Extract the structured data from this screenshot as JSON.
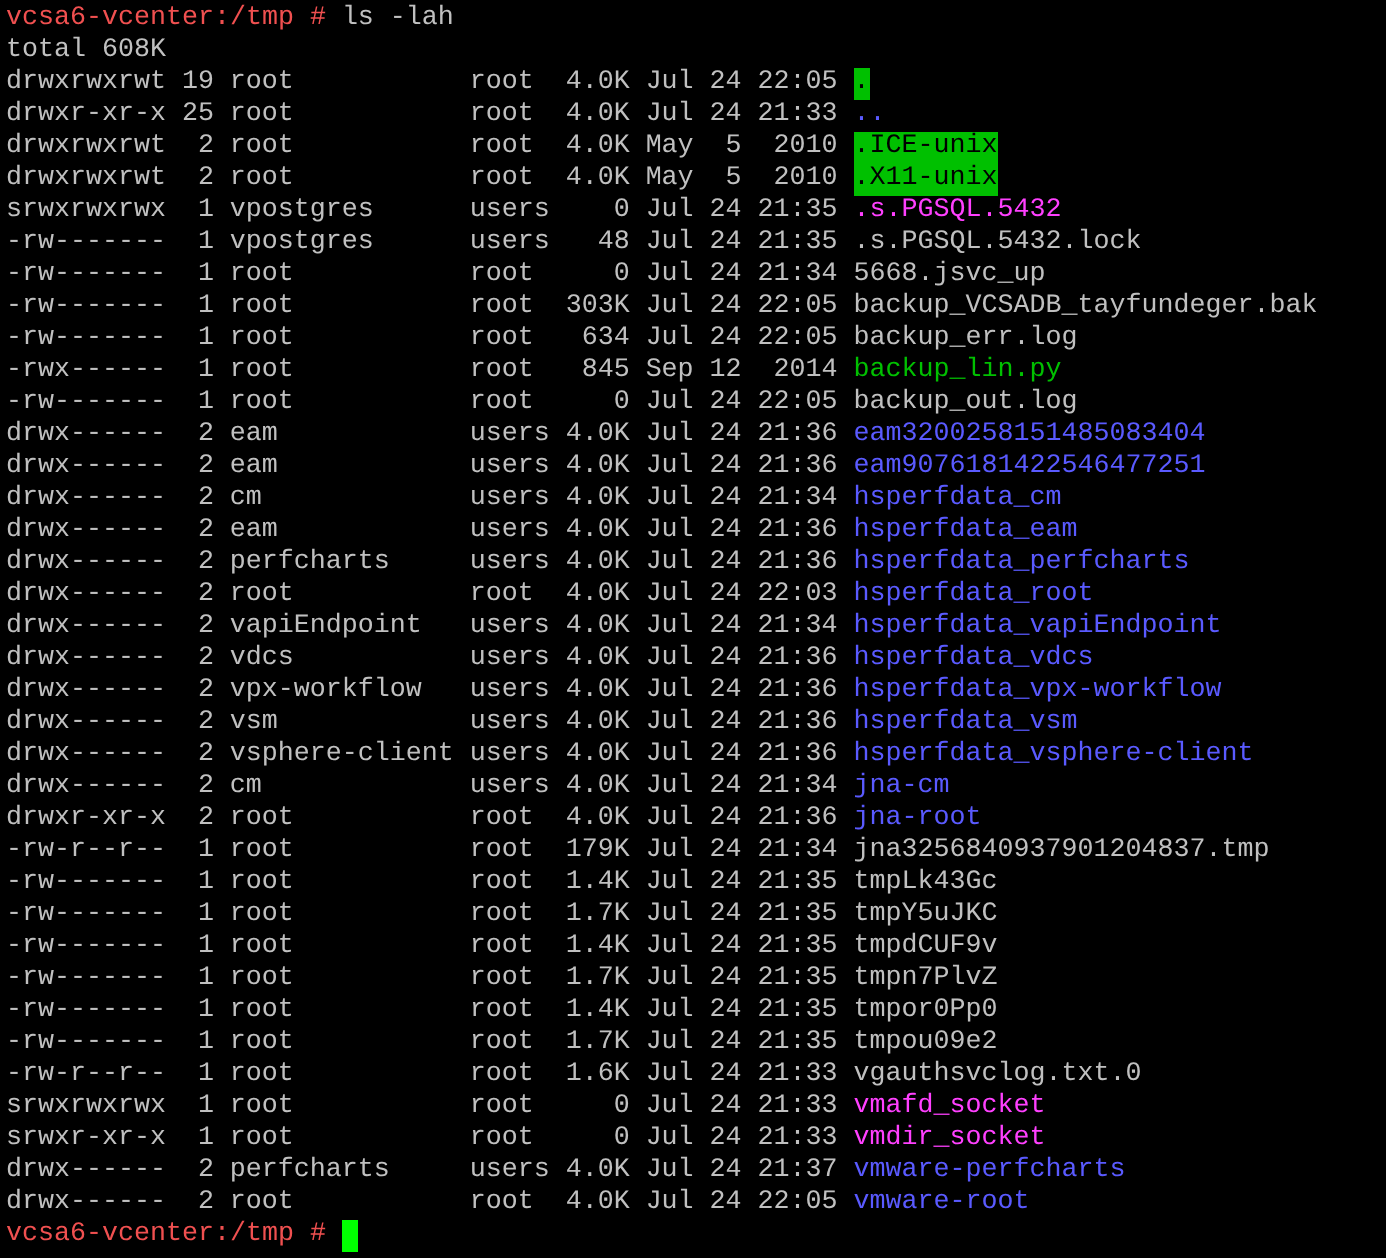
{
  "prompt_top": {
    "host": "vcsa6-vcenter:/tmp",
    "symbol": "#",
    "command": "ls -lah"
  },
  "total": "total 608K",
  "entries": [
    {
      "perms": "drwxrwxrwt",
      "links": "19",
      "owner": "root",
      "group": "root",
      "size": "4.0K",
      "date": "Jul 24 22:05",
      "name": ".",
      "kind": "sticky_dir"
    },
    {
      "perms": "drwxr-xr-x",
      "links": "25",
      "owner": "root",
      "group": "root",
      "size": "4.0K",
      "date": "Jul 24 21:33",
      "name": "..",
      "kind": "dir"
    },
    {
      "perms": "drwxrwxrwt",
      "links": "2",
      "owner": "root",
      "group": "root",
      "size": "4.0K",
      "date": "May  5  2010",
      "name": ".ICE-unix",
      "kind": "sticky_dir"
    },
    {
      "perms": "drwxrwxrwt",
      "links": "2",
      "owner": "root",
      "group": "root",
      "size": "4.0K",
      "date": "May  5  2010",
      "name": ".X11-unix",
      "kind": "sticky_dir"
    },
    {
      "perms": "srwxrwxrwx",
      "links": "1",
      "owner": "vpostgres",
      "group": "users",
      "size": "0",
      "date": "Jul 24 21:35",
      "name": ".s.PGSQL.5432",
      "kind": "socket"
    },
    {
      "perms": "-rw-------",
      "links": "1",
      "owner": "vpostgres",
      "group": "users",
      "size": "48",
      "date": "Jul 24 21:35",
      "name": ".s.PGSQL.5432.lock",
      "kind": "file"
    },
    {
      "perms": "-rw-------",
      "links": "1",
      "owner": "root",
      "group": "root",
      "size": "0",
      "date": "Jul 24 21:34",
      "name": "5668.jsvc_up",
      "kind": "file"
    },
    {
      "perms": "-rw-------",
      "links": "1",
      "owner": "root",
      "group": "root",
      "size": "303K",
      "date": "Jul 24 22:05",
      "name": "backup_VCSADB_tayfundeger.bak",
      "kind": "file"
    },
    {
      "perms": "-rw-------",
      "links": "1",
      "owner": "root",
      "group": "root",
      "size": "634",
      "date": "Jul 24 22:05",
      "name": "backup_err.log",
      "kind": "file"
    },
    {
      "perms": "-rwx------",
      "links": "1",
      "owner": "root",
      "group": "root",
      "size": "845",
      "date": "Sep 12  2014",
      "name": "backup_lin.py",
      "kind": "executable"
    },
    {
      "perms": "-rw-------",
      "links": "1",
      "owner": "root",
      "group": "root",
      "size": "0",
      "date": "Jul 24 22:05",
      "name": "backup_out.log",
      "kind": "file"
    },
    {
      "perms": "drwx------",
      "links": "2",
      "owner": "eam",
      "group": "users",
      "size": "4.0K",
      "date": "Jul 24 21:36",
      "name": "eam3200258151485083404",
      "kind": "dir"
    },
    {
      "perms": "drwx------",
      "links": "2",
      "owner": "eam",
      "group": "users",
      "size": "4.0K",
      "date": "Jul 24 21:36",
      "name": "eam9076181422546477251",
      "kind": "dir"
    },
    {
      "perms": "drwx------",
      "links": "2",
      "owner": "cm",
      "group": "users",
      "size": "4.0K",
      "date": "Jul 24 21:34",
      "name": "hsperfdata_cm",
      "kind": "dir"
    },
    {
      "perms": "drwx------",
      "links": "2",
      "owner": "eam",
      "group": "users",
      "size": "4.0K",
      "date": "Jul 24 21:36",
      "name": "hsperfdata_eam",
      "kind": "dir"
    },
    {
      "perms": "drwx------",
      "links": "2",
      "owner": "perfcharts",
      "group": "users",
      "size": "4.0K",
      "date": "Jul 24 21:36",
      "name": "hsperfdata_perfcharts",
      "kind": "dir"
    },
    {
      "perms": "drwx------",
      "links": "2",
      "owner": "root",
      "group": "root",
      "size": "4.0K",
      "date": "Jul 24 22:03",
      "name": "hsperfdata_root",
      "kind": "dir"
    },
    {
      "perms": "drwx------",
      "links": "2",
      "owner": "vapiEndpoint",
      "group": "users",
      "size": "4.0K",
      "date": "Jul 24 21:34",
      "name": "hsperfdata_vapiEndpoint",
      "kind": "dir"
    },
    {
      "perms": "drwx------",
      "links": "2",
      "owner": "vdcs",
      "group": "users",
      "size": "4.0K",
      "date": "Jul 24 21:36",
      "name": "hsperfdata_vdcs",
      "kind": "dir"
    },
    {
      "perms": "drwx------",
      "links": "2",
      "owner": "vpx-workflow",
      "group": "users",
      "size": "4.0K",
      "date": "Jul 24 21:36",
      "name": "hsperfdata_vpx-workflow",
      "kind": "dir"
    },
    {
      "perms": "drwx------",
      "links": "2",
      "owner": "vsm",
      "group": "users",
      "size": "4.0K",
      "date": "Jul 24 21:36",
      "name": "hsperfdata_vsm",
      "kind": "dir"
    },
    {
      "perms": "drwx------",
      "links": "2",
      "owner": "vsphere-client",
      "group": "users",
      "size": "4.0K",
      "date": "Jul 24 21:36",
      "name": "hsperfdata_vsphere-client",
      "kind": "dir"
    },
    {
      "perms": "drwx------",
      "links": "2",
      "owner": "cm",
      "group": "users",
      "size": "4.0K",
      "date": "Jul 24 21:34",
      "name": "jna-cm",
      "kind": "dir"
    },
    {
      "perms": "drwxr-xr-x",
      "links": "2",
      "owner": "root",
      "group": "root",
      "size": "4.0K",
      "date": "Jul 24 21:36",
      "name": "jna-root",
      "kind": "dir"
    },
    {
      "perms": "-rw-r--r--",
      "links": "1",
      "owner": "root",
      "group": "root",
      "size": "179K",
      "date": "Jul 24 21:34",
      "name": "jna3256840937901204837.tmp",
      "kind": "file"
    },
    {
      "perms": "-rw-------",
      "links": "1",
      "owner": "root",
      "group": "root",
      "size": "1.4K",
      "date": "Jul 24 21:35",
      "name": "tmpLk43Gc",
      "kind": "file"
    },
    {
      "perms": "-rw-------",
      "links": "1",
      "owner": "root",
      "group": "root",
      "size": "1.7K",
      "date": "Jul 24 21:35",
      "name": "tmpY5uJKC",
      "kind": "file"
    },
    {
      "perms": "-rw-------",
      "links": "1",
      "owner": "root",
      "group": "root",
      "size": "1.4K",
      "date": "Jul 24 21:35",
      "name": "tmpdCUF9v",
      "kind": "file"
    },
    {
      "perms": "-rw-------",
      "links": "1",
      "owner": "root",
      "group": "root",
      "size": "1.7K",
      "date": "Jul 24 21:35",
      "name": "tmpn7PlvZ",
      "kind": "file"
    },
    {
      "perms": "-rw-------",
      "links": "1",
      "owner": "root",
      "group": "root",
      "size": "1.4K",
      "date": "Jul 24 21:35",
      "name": "tmpor0Pp0",
      "kind": "file"
    },
    {
      "perms": "-rw-------",
      "links": "1",
      "owner": "root",
      "group": "root",
      "size": "1.7K",
      "date": "Jul 24 21:35",
      "name": "tmpou09e2",
      "kind": "file"
    },
    {
      "perms": "-rw-r--r--",
      "links": "1",
      "owner": "root",
      "group": "root",
      "size": "1.6K",
      "date": "Jul 24 21:33",
      "name": "vgauthsvclog.txt.0",
      "kind": "file"
    },
    {
      "perms": "srwxrwxrwx",
      "links": "1",
      "owner": "root",
      "group": "root",
      "size": "0",
      "date": "Jul 24 21:33",
      "name": "vmafd_socket",
      "kind": "socket"
    },
    {
      "perms": "srwxr-xr-x",
      "links": "1",
      "owner": "root",
      "group": "root",
      "size": "0",
      "date": "Jul 24 21:33",
      "name": "vmdir_socket",
      "kind": "socket"
    },
    {
      "perms": "drwx------",
      "links": "2",
      "owner": "perfcharts",
      "group": "users",
      "size": "4.0K",
      "date": "Jul 24 21:37",
      "name": "vmware-perfcharts",
      "kind": "dir"
    },
    {
      "perms": "drwx------",
      "links": "2",
      "owner": "root",
      "group": "root",
      "size": "4.0K",
      "date": "Jul 24 22:05",
      "name": "vmware-root",
      "kind": "dir"
    }
  ],
  "prompt_bottom": {
    "host": "vcsa6-vcenter:/tmp",
    "symbol": "#"
  }
}
